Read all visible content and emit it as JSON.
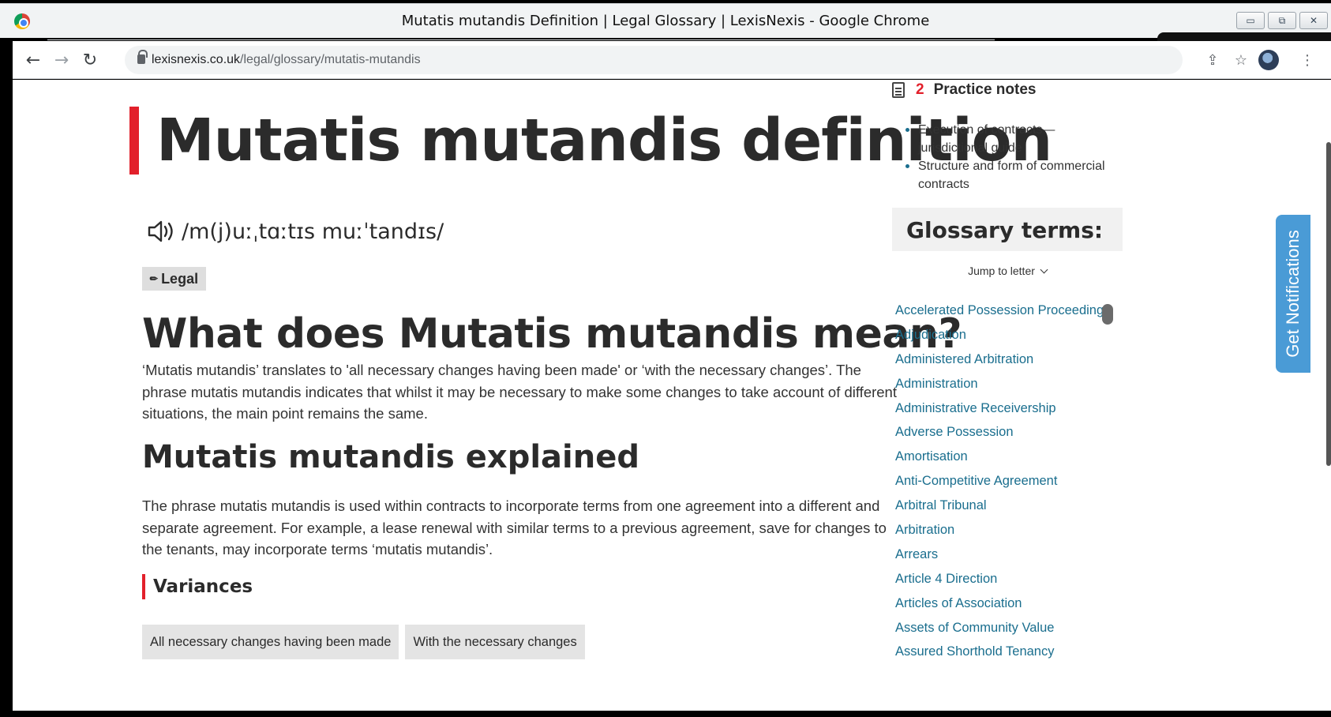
{
  "window": {
    "title": "Mutatis mutandis Definition | Legal Glossary | LexisNexis - Google Chrome",
    "controls": [
      "minimize",
      "restore",
      "close"
    ]
  },
  "toolbar": {
    "url_host": "lexisnexis.co.uk",
    "url_path": "/legal/glossary/mutatis-mutandis",
    "back": "←",
    "forward": "→",
    "reload": "↻",
    "share": "⇪",
    "bookmark": "☆",
    "menu": "⋮",
    "minimize_glyph": "▭",
    "restore_glyph": "⧉",
    "close_glyph": "✕"
  },
  "article": {
    "title": "Mutatis mutandis definition",
    "pronunciation": "/m(j)uːˌtɑːtɪs muːˈtandɪs/",
    "tag": "Legal",
    "question_heading": "What does Mutatis mutandis mean?",
    "definition": "‘Mutatis mutandis’ translates to 'all necessary changes having been made' or ‘with the necessary changes’. The phrase mutatis mutandis indicates that whilst it may be necessary to make some changes to take account of different situations, the main point remains the same.",
    "explained_heading": "Mutatis mutandis explained",
    "explained_text": "The phrase mutatis mutandis is used within contracts to incorporate terms from one agreement into a different and separate agreement. For example, a lease renewal with similar terms to a previous agreement, save for changes to the tenants, may incorporate terms ‘mutatis mutandis’.",
    "variances_heading": "Variances",
    "variances": [
      "All necessary changes having been made",
      "With the necessary changes"
    ]
  },
  "sidebar": {
    "practice_notes_count": "2",
    "practice_notes_label": "Practice notes",
    "practice_notes": [
      "Execution of contracts—jurisdictional guide",
      "Structure and form of commercial contracts"
    ],
    "glossary_title": "Glossary terms:",
    "jump_label": "Jump to letter",
    "terms": [
      "Accelerated Possession Proceedings",
      "Adjudication",
      "Administered Arbitration",
      "Administration",
      "Administrative Receivership",
      "Adverse Possession",
      "Amortisation",
      "Anti-Competitive Agreement",
      "Arbitral Tribunal",
      "Arbitration",
      "Arrears",
      "Article 4 Direction",
      "Articles of Association",
      "Assets of Community Value",
      "Assured Shorthold Tenancy"
    ]
  },
  "notifications_tab": "Get Notifications",
  "colors": {
    "accent": "#e2202b",
    "link": "#1a6e8e",
    "notif": "#4a9bd6"
  }
}
